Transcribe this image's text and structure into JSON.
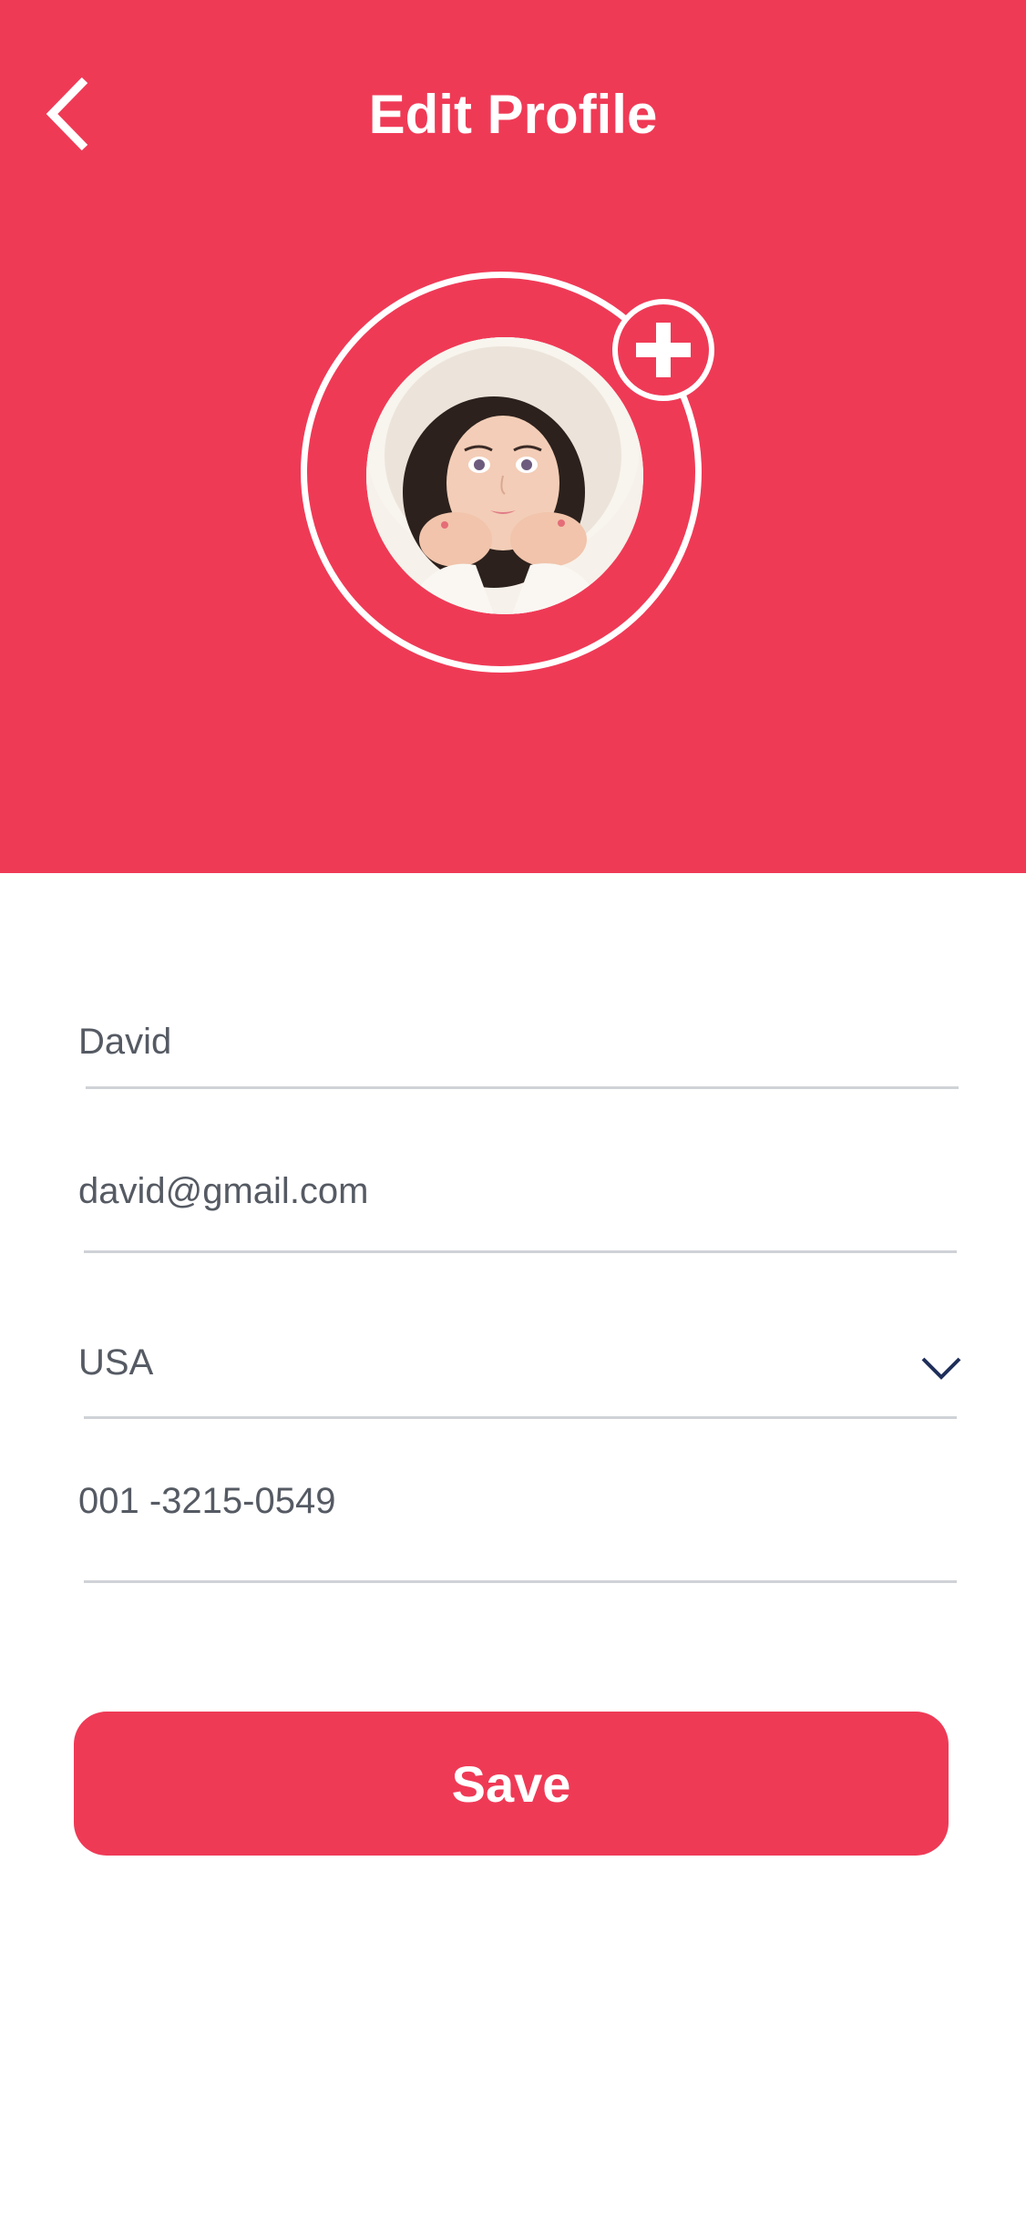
{
  "header": {
    "title": "Edit Profile",
    "back_icon": "chevron-left-icon",
    "background_color": "#ef3a56"
  },
  "avatar": {
    "add_icon": "plus-icon"
  },
  "form": {
    "name_value": "David",
    "email_value": "david@gmail.com",
    "country_value": "USA",
    "country_dropdown_icon": "chevron-down-icon",
    "phone_value": "001 -3215-0549"
  },
  "actions": {
    "save_label": "Save"
  },
  "colors": {
    "accent": "#ef3a56",
    "text": "#555a63",
    "divider": "#cfd2d6",
    "dropdown_chevron": "#1f2f5a"
  }
}
